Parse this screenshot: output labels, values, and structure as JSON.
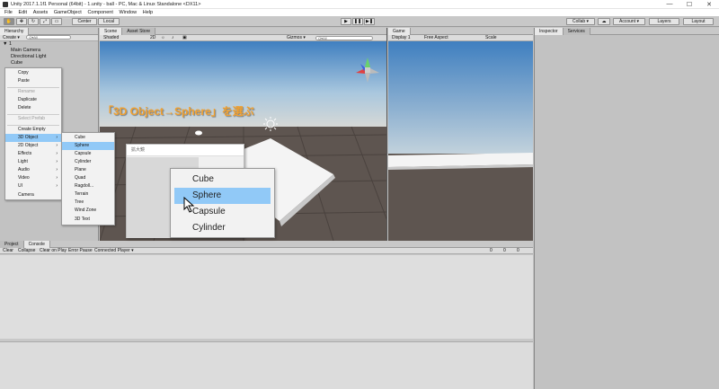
{
  "title_bar": {
    "title": "Unity 2017.1.1f1 Personal (64bit) - 1.unity - ball - PC, Mac & Linux Standalone <DX11>",
    "minimize": "—",
    "maximize": "☐",
    "close": "✕"
  },
  "menu_bar": [
    "File",
    "Edit",
    "Assets",
    "GameObject",
    "Component",
    "Window",
    "Help"
  ],
  "toolbar": {
    "center": "Center",
    "local": "Local",
    "collab": "Collab ▾",
    "account": "Account ▾",
    "layers": "Layers",
    "layout": "Layout"
  },
  "hierarchy": {
    "tab": "Hierarchy",
    "create": "Create ▾",
    "search_placeholder": "Q▾All",
    "scene_name": "1",
    "items": [
      "Main Camera",
      "Directional Light",
      "Cube"
    ]
  },
  "context_menu": {
    "items": [
      {
        "label": "Copy",
        "disabled": false
      },
      {
        "label": "Paste",
        "disabled": false
      },
      {
        "label": "Rename",
        "disabled": true
      },
      {
        "label": "Duplicate",
        "disabled": false
      },
      {
        "label": "Delete",
        "disabled": false
      },
      {
        "label": "Select Prefab",
        "disabled": true
      },
      {
        "label": "Create Empty",
        "disabled": false
      },
      {
        "label": "3D Object",
        "disabled": false,
        "submenu": true,
        "highlighted": true
      },
      {
        "label": "2D Object",
        "submenu": true
      },
      {
        "label": "Effects",
        "submenu": true
      },
      {
        "label": "Light",
        "submenu": true
      },
      {
        "label": "Audio",
        "submenu": true
      },
      {
        "label": "Video",
        "submenu": true
      },
      {
        "label": "UI",
        "submenu": true
      },
      {
        "label": "Camera"
      }
    ]
  },
  "submenu_3d": [
    "Cube",
    "Sphere",
    "Capsule",
    "Cylinder",
    "Plane",
    "Quad",
    "Ragdoll...",
    "Terrain",
    "Tree",
    "Wind Zone",
    "3D Text"
  ],
  "submenu_selected": "Sphere",
  "scene": {
    "tabs": [
      "Scene",
      "Asset Store"
    ],
    "shading": "Shaded",
    "mode_2d": "2D",
    "gizmos": "Gizmos ▾",
    "search": "Q▾All",
    "annotation": "「3D Object→Sphere」を選ぶ"
  },
  "zoom_window": {
    "title": "拡大鏡",
    "items": [
      "Cube",
      "Sphere",
      "Capsule",
      "Cylinder"
    ],
    "selected": "Sphere"
  },
  "game": {
    "tab": "Game",
    "display": "Display 1",
    "aspect": "Free Aspect",
    "scale": "Scale"
  },
  "inspector": {
    "tabs": [
      "Inspector",
      "Services"
    ]
  },
  "console": {
    "tabs": [
      "Project",
      "Console"
    ],
    "buttons": [
      "Clear",
      "Collapse",
      "Clear on Play",
      "Error Pause",
      "Connected Player ▾"
    ],
    "counts": [
      "0",
      "0",
      "0"
    ]
  },
  "colors": {
    "highlight": "#91c9f7",
    "annotation": "#f0a030"
  }
}
